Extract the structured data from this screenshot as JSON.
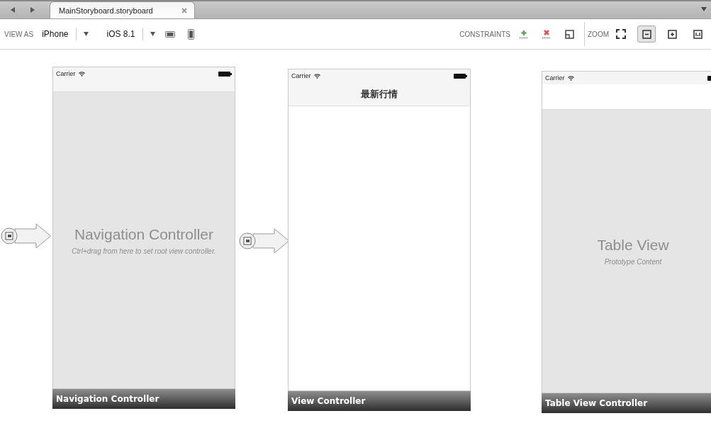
{
  "tabs": [
    {
      "label": "MainStoryboard.storyboard",
      "selected": true
    }
  ],
  "toolbar": {
    "view_as_label": "VIEW AS",
    "device": "iPhone",
    "os": "iOS 8.1",
    "constraints_label": "CONSTRAINTS",
    "zoom_label": "ZOOM",
    "zoom_buttons": [
      {
        "kind": "fit",
        "selected": false
      },
      {
        "kind": "out",
        "selected": true
      },
      {
        "kind": "in",
        "selected": false
      },
      {
        "kind": "actual",
        "selected": false
      }
    ]
  },
  "scenes": [
    {
      "kind": "navigation",
      "carrier": "Carrier",
      "heading": "Navigation Controller",
      "hint": "Ctrl+drag from here to set root view controller.",
      "footer": "Navigation Controller"
    },
    {
      "kind": "view",
      "carrier": "Carrier",
      "nav_title": "最新行情",
      "footer": "View Controller"
    },
    {
      "kind": "table",
      "carrier": "Carrier",
      "heading": "Table View",
      "hint": "Prototype Content",
      "footer": "Table View Controller"
    }
  ],
  "connections": [
    {
      "kind": "entry"
    },
    {
      "kind": "segue"
    }
  ]
}
